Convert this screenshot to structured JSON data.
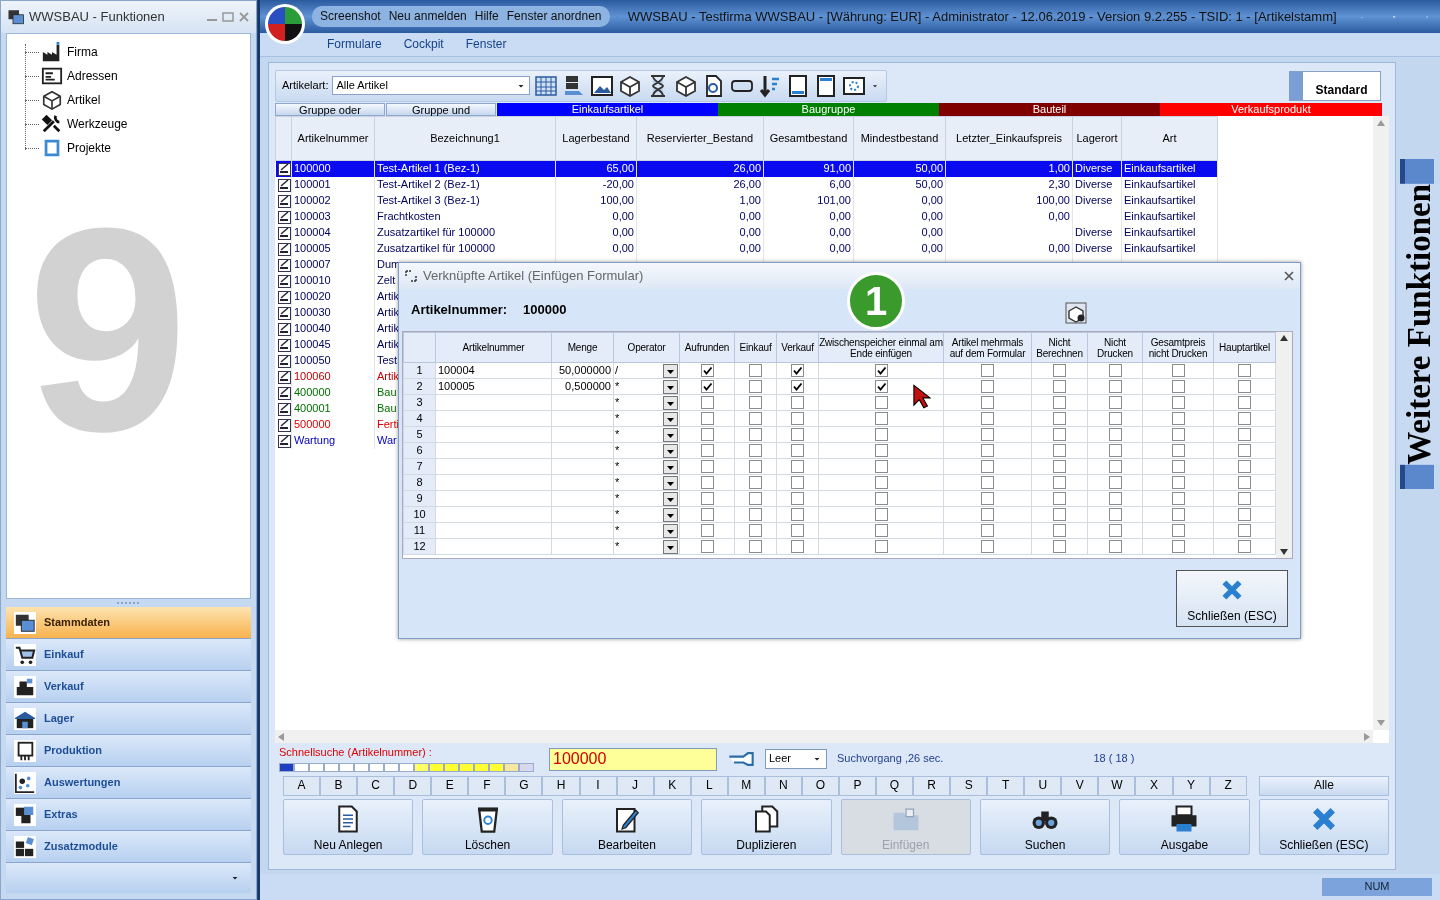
{
  "left_window": {
    "title": "WWSBAU - Funktionen",
    "tree": [
      {
        "label": "Firma"
      },
      {
        "label": "Adressen"
      },
      {
        "label": "Artikel"
      },
      {
        "label": "Werkzeuge"
      },
      {
        "label": "Projekte"
      }
    ],
    "background_logo": "9",
    "nav": [
      {
        "label": "Stammdaten",
        "selected": true
      },
      {
        "label": "Einkauf",
        "selected": false
      },
      {
        "label": "Verkauf",
        "selected": false
      },
      {
        "label": "Lager",
        "selected": false
      },
      {
        "label": "Produktion",
        "selected": false
      },
      {
        "label": "Auswertungen",
        "selected": false
      },
      {
        "label": "Extras",
        "selected": false
      },
      {
        "label": "Zusatzmodule",
        "selected": false
      }
    ]
  },
  "main_window": {
    "quick_access": [
      "Screenshot",
      "Neu anmelden",
      "Hilfe",
      "Fenster anordnen"
    ],
    "title": "WWSBAU - Testfirma WWSBAU - [Währung: EUR] - Administrator - 12.06.2019 - Version 9.2.255 - TSID: 1  - [Artikelstamm]",
    "menu": [
      "Formulare",
      "Cockpit",
      "Fenster"
    ]
  },
  "toolbar": {
    "label": "Artikelart:",
    "select": "Alle Artikel",
    "standard_button": "Standard"
  },
  "legend": [
    {
      "label": "Gruppe oder",
      "kind": "button"
    },
    {
      "label": "Gruppe und",
      "kind": "button"
    },
    {
      "label": "Einkaufsartikel",
      "kind": "color",
      "color": "#0000ff"
    },
    {
      "label": "Baugruppe",
      "kind": "color",
      "color": "#008000"
    },
    {
      "label": "Bauteil",
      "kind": "color",
      "color": "#800000"
    },
    {
      "label": "Verkaufsprodukt",
      "kind": "color",
      "color": "#ff0000"
    }
  ],
  "table": {
    "columns": [
      "Artikelnummer",
      "Bezeichnung1",
      "Lagerbestand",
      "Reservierter_Bestand",
      "Gesamtbestand",
      "Mindestbestand",
      "Letzter_Einkaufspreis",
      "Lagerort",
      "Art"
    ],
    "rows": [
      {
        "selected": true,
        "kind": "purchase",
        "cells": {
          "Artikelnummer": "100000",
          "Bezeichnung1": "Test-Artikel 1  (Bez-1)",
          "Lagerbestand": "65,00",
          "Reservierter_Bestand": "26,00",
          "Gesamtbestand": "91,00",
          "Mindestbestand": "50,00",
          "Letzter_Einkaufspreis": "1,00",
          "Lagerort": "Diverse",
          "Art": "Einkaufsartikel"
        }
      },
      {
        "selected": false,
        "kind": "purchase",
        "cells": {
          "Artikelnummer": "100001",
          "Bezeichnung1": "Test-Artikel 2  (Bez-1)",
          "Lagerbestand": "-20,00",
          "Reservierter_Bestand": "26,00",
          "Gesamtbestand": "6,00",
          "Mindestbestand": "50,00",
          "Letzter_Einkaufspreis": "2,30",
          "Lagerort": "Diverse",
          "Art": "Einkaufsartikel"
        }
      },
      {
        "selected": false,
        "kind": "purchase",
        "cells": {
          "Artikelnummer": "100002",
          "Bezeichnung1": "Test-Artikel 3  (Bez-1)",
          "Lagerbestand": "100,00",
          "Reservierter_Bestand": "1,00",
          "Gesamtbestand": "101,00",
          "Mindestbestand": "0,00",
          "Letzter_Einkaufspreis": "100,00",
          "Lagerort": "Diverse",
          "Art": "Einkaufsartikel"
        }
      },
      {
        "selected": false,
        "kind": "purchase",
        "cells": {
          "Artikelnummer": "100003",
          "Bezeichnung1": "Frachtkosten",
          "Lagerbestand": "0,00",
          "Reservierter_Bestand": "0,00",
          "Gesamtbestand": "0,00",
          "Mindestbestand": "0,00",
          "Letzter_Einkaufspreis": "0,00",
          "Art": "Einkaufsartikel"
        }
      },
      {
        "selected": false,
        "kind": "purchase",
        "cells": {
          "Artikelnummer": "100004",
          "Bezeichnung1": "Zusatzartikel für 100000",
          "Lagerbestand": "0,00",
          "Reservierter_Bestand": "0,00",
          "Gesamtbestand": "0,00",
          "Mindestbestand": "0,00",
          "Lagerort": "Diverse",
          "Art": "Einkaufsartikel"
        }
      },
      {
        "selected": false,
        "kind": "purchase",
        "cells": {
          "Artikelnummer": "100005",
          "Bezeichnung1": "Zusatzartikel für 100000",
          "Lagerbestand": "0,00",
          "Reservierter_Bestand": "0,00",
          "Gesamtbestand": "0,00",
          "Mindestbestand": "0,00",
          "Letzter_Einkaufspreis": "0,00",
          "Lagerort": "Diverse",
          "Art": "Einkaufsartikel"
        }
      },
      {
        "selected": false,
        "kind": "purchase",
        "cells": {
          "Artikelnummer": "100007",
          "Bezeichnung1": "Dum"
        }
      },
      {
        "selected": false,
        "kind": "purchase",
        "cells": {
          "Artikelnummer": "100010",
          "Bezeichnung1": "Zelt"
        }
      },
      {
        "selected": false,
        "kind": "purchase",
        "cells": {
          "Artikelnummer": "100020",
          "Bezeichnung1": "Artik"
        }
      },
      {
        "selected": false,
        "kind": "purchase",
        "cells": {
          "Artikelnummer": "100030",
          "Bezeichnung1": "Artik"
        }
      },
      {
        "selected": false,
        "kind": "purchase",
        "cells": {
          "Artikelnummer": "100040",
          "Bezeichnung1": "Artik"
        }
      },
      {
        "selected": false,
        "kind": "purchase",
        "cells": {
          "Artikelnummer": "100045",
          "Bezeichnung1": "Artik"
        }
      },
      {
        "selected": false,
        "kind": "purchase",
        "cells": {
          "Artikelnummer": "100050",
          "Bezeichnung1": "Test"
        }
      },
      {
        "selected": false,
        "kind": "part",
        "cells": {
          "Artikelnummer": "100060",
          "Bezeichnung1": "Artik"
        }
      },
      {
        "selected": false,
        "kind": "assembly",
        "cells": {
          "Artikelnummer": "400000",
          "Bezeichnung1": "Bau"
        }
      },
      {
        "selected": false,
        "kind": "assembly",
        "cells": {
          "Artikelnummer": "400001",
          "Bezeichnung1": "Bau"
        }
      },
      {
        "selected": false,
        "kind": "product",
        "cells": {
          "Artikelnummer": "500000",
          "Bezeichnung1": "Ferti"
        }
      },
      {
        "selected": false,
        "kind": "service",
        "cells": {
          "Artikelnummer": "Wartung",
          "Bezeichnung1": "War"
        }
      }
    ]
  },
  "dialog": {
    "title": "Verknüpfte Artikel (Einfügen Formular)",
    "field_label": "Artikelnummer:",
    "field_value": "100000",
    "columns": [
      "Artikelnummer",
      "Menge",
      "Operator",
      "Aufrunden",
      "Einkauf",
      "Verkauf",
      "Zwischenspeicher einmal am Ende einfügen",
      "Artikel mehrmals auf dem Formular",
      "Nicht Berechnen",
      "Nicht Drucken",
      "Gesamtpreis nicht Drucken",
      "Hauptartikel"
    ],
    "rows": [
      {
        "number": "1",
        "artikelnummer": "100004",
        "menge": "50,000000",
        "operator": "/",
        "checks": [
          true,
          false,
          true,
          true,
          false,
          false,
          false,
          false,
          false
        ]
      },
      {
        "number": "2",
        "artikelnummer": "100005",
        "menge": "0,500000",
        "operator": "*",
        "checks": [
          true,
          false,
          true,
          true,
          false,
          false,
          false,
          false,
          false
        ]
      },
      {
        "number": "3",
        "operator": "*",
        "checks": [
          false,
          false,
          false,
          false,
          false,
          false,
          false,
          false,
          false
        ]
      },
      {
        "number": "4",
        "operator": "*",
        "checks": [
          false,
          false,
          false,
          false,
          false,
          false,
          false,
          false,
          false
        ]
      },
      {
        "number": "5",
        "operator": "*",
        "checks": [
          false,
          false,
          false,
          false,
          false,
          false,
          false,
          false,
          false
        ]
      },
      {
        "number": "6",
        "operator": "*",
        "checks": [
          false,
          false,
          false,
          false,
          false,
          false,
          false,
          false,
          false
        ]
      },
      {
        "number": "7",
        "operator": "*",
        "checks": [
          false,
          false,
          false,
          false,
          false,
          false,
          false,
          false,
          false
        ]
      },
      {
        "number": "8",
        "operator": "*",
        "checks": [
          false,
          false,
          false,
          false,
          false,
          false,
          false,
          false,
          false
        ]
      },
      {
        "number": "9",
        "operator": "*",
        "checks": [
          false,
          false,
          false,
          false,
          false,
          false,
          false,
          false,
          false
        ]
      },
      {
        "number": "10",
        "operator": "*",
        "checks": [
          false,
          false,
          false,
          false,
          false,
          false,
          false,
          false,
          false
        ]
      },
      {
        "number": "11",
        "operator": "*",
        "checks": [
          false,
          false,
          false,
          false,
          false,
          false,
          false,
          false,
          false
        ]
      },
      {
        "number": "12",
        "operator": "*",
        "checks": [
          false,
          false,
          false,
          false,
          false,
          false,
          false,
          false,
          false
        ]
      }
    ],
    "close_button": "Schließen (ESC)"
  },
  "step_badge": "1",
  "search": {
    "label": "Schnellsuche (Artikelnummer) :",
    "value": "100000",
    "select": "Leer",
    "status": "Suchvorgang ,26 sec.",
    "count": "18 ( 18 )"
  },
  "letters": [
    "A",
    "B",
    "C",
    "D",
    "E",
    "F",
    "G",
    "H",
    "I",
    "J",
    "K",
    "L",
    "M",
    "N",
    "O",
    "P",
    "Q",
    "R",
    "S",
    "T",
    "U",
    "V",
    "W",
    "X",
    "Y",
    "Z"
  ],
  "all_button": "Alle",
  "actions": [
    {
      "label": "Neu Anlegen",
      "disabled": false
    },
    {
      "label": "Löschen",
      "disabled": false
    },
    {
      "label": "Bearbeiten",
      "disabled": false
    },
    {
      "label": "Duplizieren",
      "disabled": false
    },
    {
      "label": "Einfügen",
      "disabled": true
    },
    {
      "label": "Suchen",
      "disabled": false
    },
    {
      "label": "Ausgabe",
      "disabled": false
    },
    {
      "label": "Schließen (ESC)",
      "disabled": false
    }
  ],
  "side_panel": "Weitere Funktionen",
  "status_bar": "NUM"
}
